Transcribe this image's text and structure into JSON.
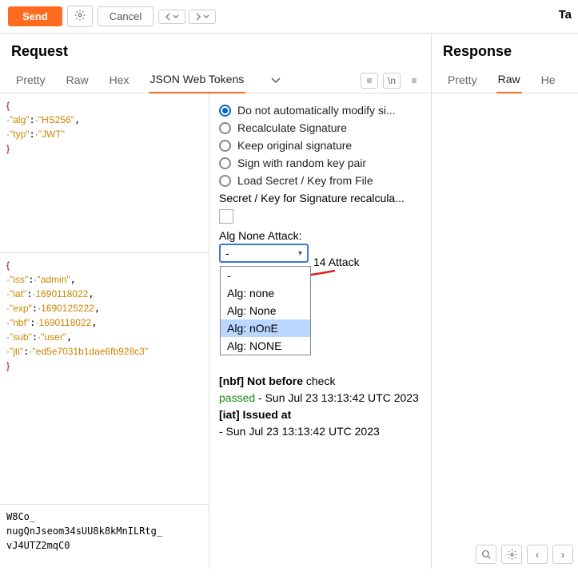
{
  "toolbar": {
    "send": "Send",
    "cancel": "Cancel",
    "top_right": "Ta"
  },
  "request": {
    "title": "Request",
    "tabs": [
      "Pretty",
      "Raw",
      "Hex",
      "JSON Web Tokens"
    ],
    "active_tab": 3
  },
  "response": {
    "title": "Response",
    "tabs": [
      "Pretty",
      "Raw",
      "He"
    ],
    "active_tab": 1
  },
  "jwt_header": {
    "alg": "HS256",
    "typ": "JWT"
  },
  "jwt_payload": {
    "iss": "admin",
    "iat": 1690118022,
    "exp": 1690125222,
    "nbf": 1690118022,
    "sub": "user",
    "jti": "ed5e7031b1dae6fb928c3"
  },
  "jwt_signature": "W8Co_\nnugQnJseom34sUU8k8kMnILRtg_\nvJ4UTZ2mqC0",
  "jwt_options": {
    "radios": [
      "Do not automatically modify si...",
      "Recalculate Signature",
      "Keep original signature",
      "Sign with random key pair",
      "Load Secret / Key from File"
    ],
    "selected_radio": 0,
    "secret_label": "Secret / Key for Signature recalcula...",
    "alg_label": "Alg None Attack:",
    "combo_selected": "-",
    "dropdown_items": [
      "-",
      "Alg: none",
      "Alg: None",
      "Alg: nOnE",
      "Alg: NONE"
    ],
    "highlighted": 3,
    "attack_text": "14 Attack"
  },
  "analysis": {
    "nbf_label": "[nbf] Not before",
    "nbf_status": "check",
    "passed": "passed",
    "nbf_time": " - Sun Jul 23 13:13:42 UTC 2023",
    "iat_label": "[iat] Issued at",
    "iat_time": "- Sun Jul 23 13:13:42 UTC 2023"
  }
}
